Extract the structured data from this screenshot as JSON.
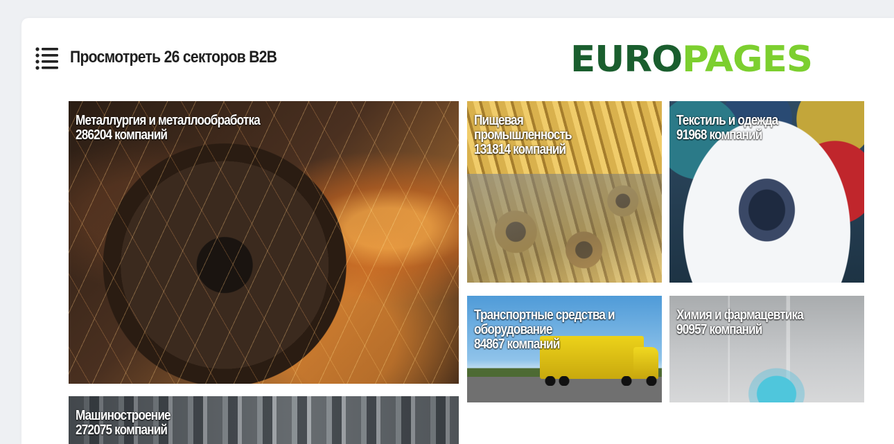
{
  "header": {
    "title": "Просмотреть 26 секторов B2B",
    "icon": "list-icon"
  },
  "logo": {
    "part1": "EURO",
    "part2": "PAGES",
    "color_dark": "#1a5e2e",
    "color_light": "#7ccf2f"
  },
  "sectors": [
    {
      "name": "Металлургия и металлообработка",
      "count": "286204 компаний"
    },
    {
      "name_line1": "Пищевая",
      "name_line2": "промышленность",
      "count": "131814 компаний"
    },
    {
      "name": "Текстиль и одежда",
      "count": "91968 компаний"
    },
    {
      "name_line1": "Транспортные средства и",
      "name_line2": "оборудование",
      "count": "84867 компаний"
    },
    {
      "name": "Химия и фармацевтика",
      "count": "90957 компаний"
    },
    {
      "name": "Машиностроение",
      "count": "272075 компаний"
    }
  ]
}
